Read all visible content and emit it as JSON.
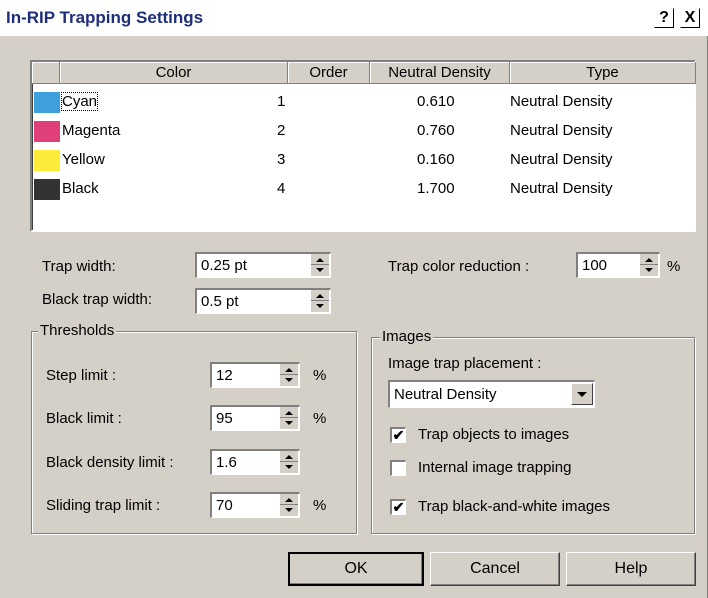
{
  "window": {
    "title": "In-RIP Trapping Settings",
    "help_glyph": "?",
    "close_glyph": "X"
  },
  "table": {
    "columns": [
      "Color",
      "Order",
      "Neutral Density",
      "Type"
    ],
    "rows": [
      {
        "color": "Cyan",
        "swatch": "#3da0dc",
        "order": "1",
        "nd": "0.610",
        "type": "Neutral Density"
      },
      {
        "color": "Magenta",
        "swatch": "#e0407a",
        "order": "2",
        "nd": "0.760",
        "type": "Neutral Density"
      },
      {
        "color": "Yellow",
        "swatch": "#ffec3a",
        "order": "3",
        "nd": "0.160",
        "type": "Neutral Density"
      },
      {
        "color": "Black",
        "swatch": "#333333",
        "order": "4",
        "nd": "1.700",
        "type": "Neutral Density"
      }
    ]
  },
  "trap": {
    "width_label": "Trap width:",
    "width_value": "0.25 pt",
    "black_width_label": "Black trap width:",
    "black_width_value": "0.5 pt",
    "reduction_label": "Trap color reduction :",
    "reduction_value": "100",
    "reduction_unit": "%"
  },
  "thresholds": {
    "label": "Thresholds",
    "step_label": "Step limit :",
    "step_value": "12",
    "step_unit": "%",
    "black_label": "Black limit :",
    "black_value": "95",
    "black_unit": "%",
    "density_label": "Black density limit :",
    "density_value": "1.6",
    "sliding_label": "Sliding trap limit :",
    "sliding_value": "70",
    "sliding_unit": "%"
  },
  "images": {
    "label": "Images",
    "placement_label": "Image trap placement :",
    "placement_value": "Neutral Density",
    "trap_objects_label": "Trap objects to images",
    "trap_objects_checked": true,
    "internal_label": "Internal image trapping",
    "internal_checked": false,
    "bw_label": "Trap black-and-white images",
    "bw_checked": true,
    "check_glyph": "✔"
  },
  "buttons": {
    "ok": "OK",
    "cancel": "Cancel",
    "help": "Help"
  }
}
